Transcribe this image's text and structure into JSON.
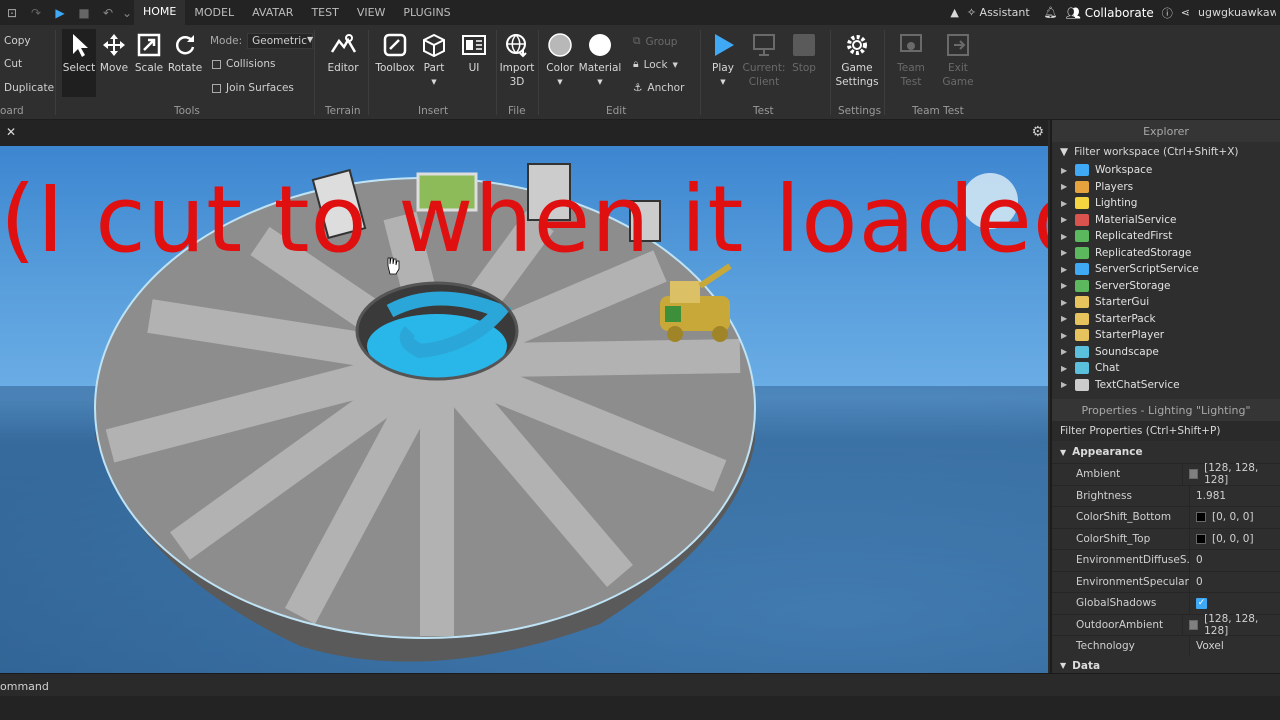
{
  "topbar": {
    "tabs": [
      "HOME",
      "MODEL",
      "AVATAR",
      "TEST",
      "VIEW",
      "PLUGINS"
    ],
    "active_tab": "HOME",
    "assistant": "Assistant",
    "collaborate": "Collaborate",
    "username": "ugwgkuawkawhf"
  },
  "ribbon": {
    "clipboard": {
      "copy": "Copy",
      "cut": "Cut",
      "duplicate": "Duplicate",
      "label": "oard"
    },
    "tools": {
      "select": "Select",
      "move": "Move",
      "scale": "Scale",
      "rotate": "Rotate",
      "mode_label": "Mode:",
      "mode_value": "Geometric",
      "collisions": "Collisions",
      "join_surfaces": "Join Surfaces",
      "label": "Tools"
    },
    "terrain": {
      "editor": "Editor",
      "label": "Terrain"
    },
    "insert": {
      "toolbox": "Toolbox",
      "part": "Part",
      "ui": "UI",
      "label": "Insert"
    },
    "file": {
      "import3d_line1": "Import",
      "import3d_line2": "3D",
      "label": "File"
    },
    "edit": {
      "color": "Color",
      "material": "Material",
      "group": "Group",
      "lock": "Lock",
      "anchor": "Anchor",
      "label": "Edit"
    },
    "test": {
      "play": "Play",
      "current1": "Current:",
      "current2": "Client",
      "stop": "Stop",
      "label": "Test"
    },
    "settings": {
      "game1": "Game",
      "game2": "Settings",
      "label": "Settings"
    },
    "teamtest": {
      "team1": "Team",
      "team2": "Test",
      "exit1": "Exit",
      "exit2": "Game",
      "label": "Team Test"
    }
  },
  "viewport": {
    "caption": "(I cut to when it loaded)"
  },
  "explorer": {
    "title": "Explorer",
    "filter": "Filter workspace (Ctrl+Shift+X)",
    "items": [
      {
        "label": "Workspace",
        "color": "#3fa9f5"
      },
      {
        "label": "Players",
        "color": "#e6a23c"
      },
      {
        "label": "Lighting",
        "color": "#f5d442"
      },
      {
        "label": "MaterialService",
        "color": "#d9534f"
      },
      {
        "label": "ReplicatedFirst",
        "color": "#5cb85c"
      },
      {
        "label": "ReplicatedStorage",
        "color": "#5cb85c"
      },
      {
        "label": "ServerScriptService",
        "color": "#3fa9f5"
      },
      {
        "label": "ServerStorage",
        "color": "#5cb85c"
      },
      {
        "label": "StarterGui",
        "color": "#e6c35c"
      },
      {
        "label": "StarterPack",
        "color": "#e6c35c"
      },
      {
        "label": "StarterPlayer",
        "color": "#e6c35c"
      },
      {
        "label": "Soundscape",
        "color": "#5bc0de"
      },
      {
        "label": "Chat",
        "color": "#5bc0de"
      },
      {
        "label": "TextChatService",
        "color": "#cccccc"
      }
    ]
  },
  "properties": {
    "title": "Properties - Lighting \"Lighting\"",
    "filter": "Filter Properties (Ctrl+Shift+P)",
    "section": "Appearance",
    "rows": [
      {
        "name": "Ambient",
        "value": "[128, 128, 128]",
        "swatch": "#808080"
      },
      {
        "name": "Brightness",
        "value": "1.981"
      },
      {
        "name": "ColorShift_Bottom",
        "value": "[0, 0, 0]",
        "swatch": "#000000"
      },
      {
        "name": "ColorShift_Top",
        "value": "[0, 0, 0]",
        "swatch": "#000000"
      },
      {
        "name": "EnvironmentDiffuseS...",
        "value": "0"
      },
      {
        "name": "EnvironmentSpecular...",
        "value": "0"
      },
      {
        "name": "GlobalShadows",
        "checked": true
      },
      {
        "name": "OutdoorAmbient",
        "value": "[128, 128, 128]",
        "swatch": "#808080"
      },
      {
        "name": "Technology",
        "value": "Voxel"
      }
    ],
    "data_section": "Data"
  },
  "command": {
    "label": "ommand"
  }
}
